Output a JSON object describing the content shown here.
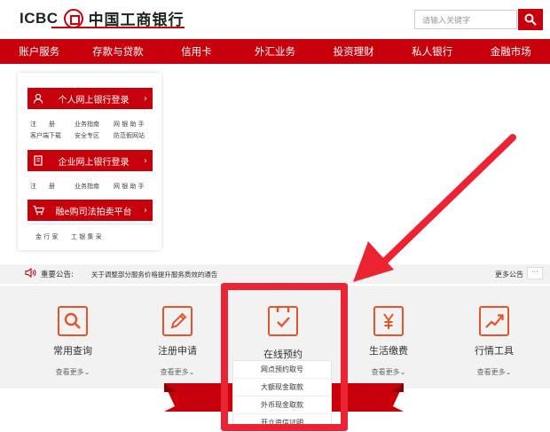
{
  "header": {
    "logo_en": "ICBC",
    "logo_cn": "中国工商银行",
    "search_placeholder": "请输入关键字"
  },
  "nav": [
    "账户服务",
    "存款与贷款",
    "信用卡",
    "外汇业务",
    "投资理财",
    "私人银行",
    "金融市场"
  ],
  "login": {
    "personal": {
      "label": "个人网上银行登录"
    },
    "personal_links_1": [
      "注　　册",
      "业务指南",
      "网 银 助 手"
    ],
    "personal_links_2": [
      "客户端下载",
      "安全专区",
      "防范假网站"
    ],
    "corporate": {
      "label": "企业网上银行登录"
    },
    "corporate_links": [
      "注　　册",
      "业务指南",
      "网 银 助 手"
    ],
    "auction": {
      "label": "融e购司法拍卖平台"
    },
    "auction_links": [
      "金 行 家",
      "工 银 集 采"
    ]
  },
  "notice": {
    "label": "重要公告:",
    "text": "关于调整部分服务价格提升服务质效的通告",
    "more": "更多公告",
    "dots": "···"
  },
  "services": [
    {
      "label": "常用查询",
      "more": "查看更多"
    },
    {
      "label": "注册申请",
      "more": "查看更多"
    },
    {
      "label": "在线预约",
      "more": ""
    },
    {
      "label": "生活缴费",
      "more": "查看更多"
    },
    {
      "label": "行情工具",
      "more": "查看更多"
    }
  ],
  "dropdown": [
    "网点预约取号",
    "大额现金取款",
    "外币现金取款",
    "开立资信证明"
  ],
  "colors": {
    "brand": "#c7000b",
    "accent": "#e2562a",
    "highlight": "#ec2332"
  }
}
